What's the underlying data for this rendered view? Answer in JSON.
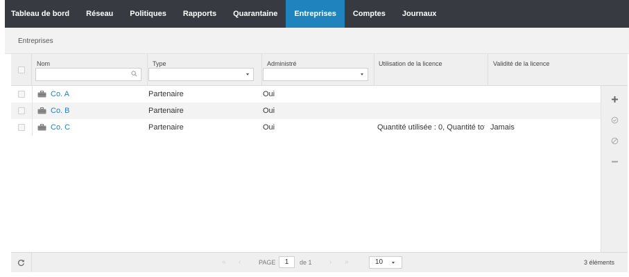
{
  "nav": {
    "items": [
      "Tableau de bord",
      "Réseau",
      "Politiques",
      "Rapports",
      "Quarantaine",
      "Entreprises",
      "Comptes",
      "Journaux"
    ],
    "active": "Entreprises"
  },
  "breadcrumb": "Entreprises",
  "table": {
    "columns": {
      "name": "Nom",
      "type": "Type",
      "managed": "Administré",
      "license_usage": "Utilisation de la licence",
      "license_validity": "Validité de la licence"
    },
    "filters": {
      "name_value": "",
      "type_value": "",
      "managed_value": ""
    },
    "rows": [
      {
        "name": "Co. A",
        "type": "Partenaire",
        "managed": "Oui",
        "license_usage": "",
        "license_validity": ""
      },
      {
        "name": "Co. B",
        "type": "Partenaire",
        "managed": "Oui",
        "license_usage": "",
        "license_validity": ""
      },
      {
        "name": "Co. C",
        "type": "Partenaire",
        "managed": "Oui",
        "license_usage": "Quantité utilisée : 0, Quantité tot...",
        "license_validity": "Jamais"
      }
    ]
  },
  "side_actions": [
    "add-icon",
    "activate-icon",
    "deactivate-icon",
    "remove-icon"
  ],
  "footer": {
    "page_label": "PAGE",
    "page_value": "1",
    "of_label": "de 1",
    "per_page": "10",
    "count": "3 éléments"
  },
  "colors": {
    "nav_bg": "#373b41",
    "nav_active": "#1f84bd",
    "link": "#2a7db8"
  }
}
